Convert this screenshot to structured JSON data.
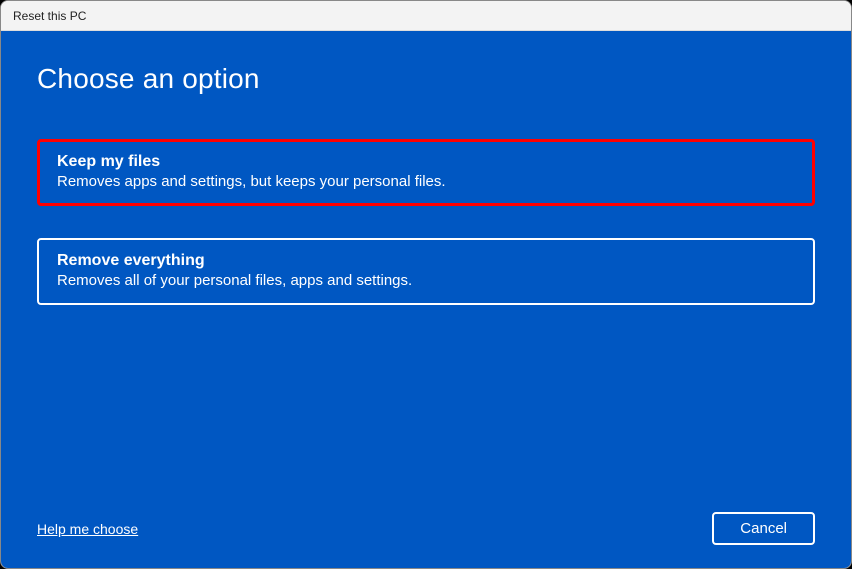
{
  "window": {
    "title": "Reset this PC"
  },
  "main": {
    "heading": "Choose an option",
    "options": [
      {
        "title": "Keep my files",
        "description": "Removes apps and settings, but keeps your personal files."
      },
      {
        "title": "Remove everything",
        "description": "Removes all of your personal files, apps and settings."
      }
    ]
  },
  "footer": {
    "help_link": "Help me choose",
    "cancel_label": "Cancel"
  }
}
